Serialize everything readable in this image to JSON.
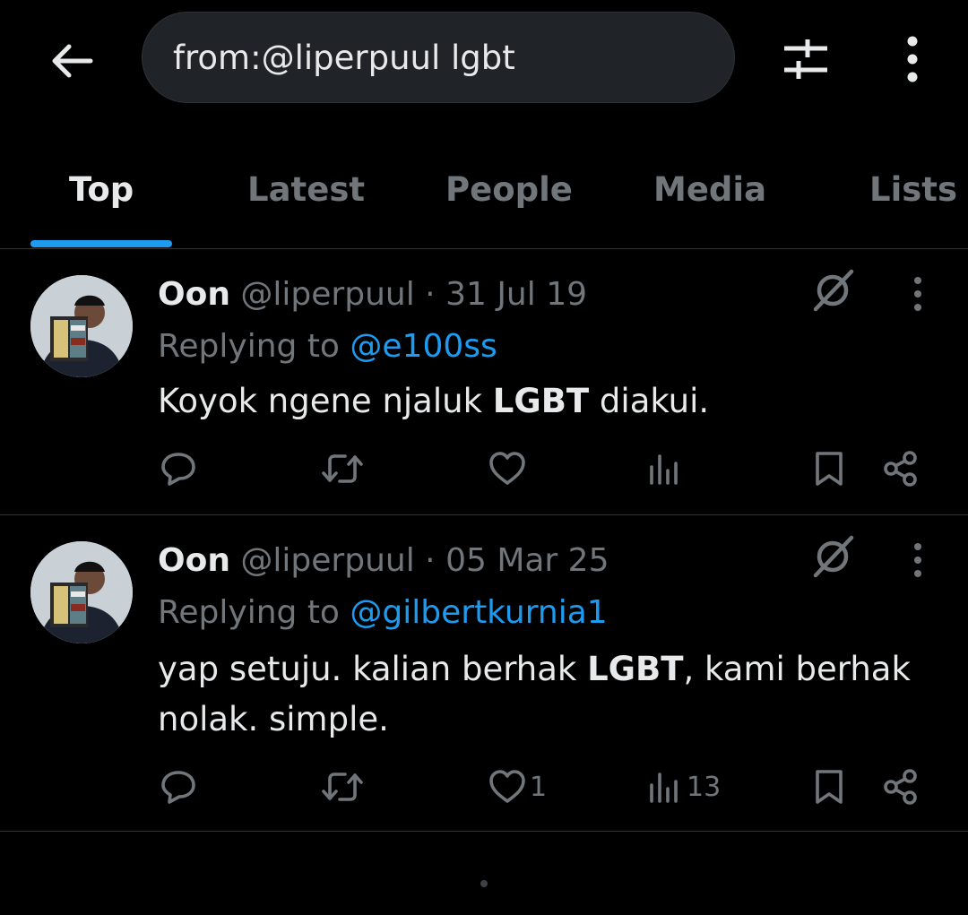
{
  "search": {
    "query": "from:@liperpuul lgbt"
  },
  "tabs": [
    {
      "label": "Top",
      "active": true
    },
    {
      "label": "Latest",
      "active": false
    },
    {
      "label": "People",
      "active": false
    },
    {
      "label": "Media",
      "active": false
    },
    {
      "label": "Lists",
      "active": false
    }
  ],
  "tweets": [
    {
      "name": "Oon",
      "handle": "@liperpuul",
      "separator": " · ",
      "date": "31 Jul 19",
      "replying_prefix": "Replying to ",
      "replying_to": "@e100ss",
      "text_parts": [
        {
          "text": "Koyok ngene njaluk ",
          "bold": false
        },
        {
          "text": "LGBT",
          "bold": true
        },
        {
          "text": " diakui.",
          "bold": false
        }
      ],
      "likes": "",
      "views": ""
    },
    {
      "name": "Oon",
      "handle": "@liperpuul",
      "separator": " · ",
      "date": "05 Mar 25",
      "replying_prefix": "Replying to ",
      "replying_to": "@gilbertkurnia1",
      "text_parts": [
        {
          "text": "yap setuju. kalian berhak ",
          "bold": false
        },
        {
          "text": "LGBT",
          "bold": true
        },
        {
          "text": ", kami berhak nolak. simple.",
          "bold": false
        }
      ],
      "likes": "1",
      "views": "13"
    }
  ],
  "icons": {
    "back": "back-arrow-icon",
    "filter": "sliders-icon",
    "more": "more-vertical-icon",
    "grok": "grok-icon",
    "reply": "reply-icon",
    "retweet": "retweet-icon",
    "like": "heart-icon",
    "views": "views-icon",
    "bookmark": "bookmark-icon",
    "share": "share-icon"
  },
  "colors": {
    "background": "#000000",
    "text": "#e7e9ea",
    "secondary": "#71767b",
    "accent": "#1d9bf0",
    "divider": "#2f3336",
    "search_bg": "#202327"
  }
}
